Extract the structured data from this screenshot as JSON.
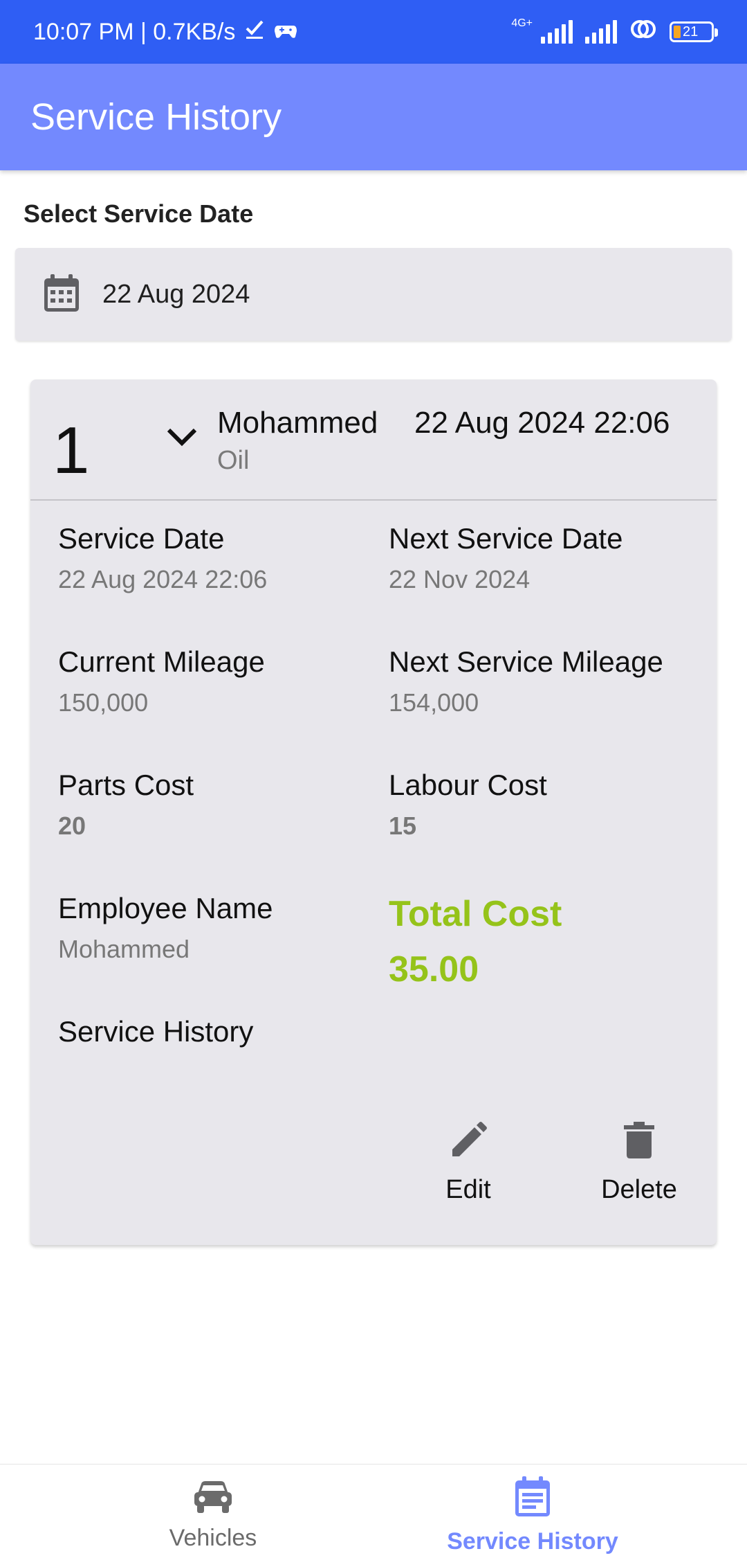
{
  "status_bar": {
    "time_speed": "10:07 PM | 0.7KB/s",
    "network": "4G+",
    "battery": "21",
    "icons": [
      "check-icon",
      "gamepad-icon",
      "signal-icon",
      "signal-icon",
      "hotspot-icon",
      "battery-icon"
    ]
  },
  "app_bar": {
    "title": "Service History"
  },
  "filter": {
    "label": "Select Service Date",
    "selected_date": "22 Aug 2024",
    "icon": "calendar-icon"
  },
  "record": {
    "number": "1",
    "employee": "Mohammed",
    "service_type": "Oil",
    "datetime": "22 Aug 2024 22:06",
    "fields": {
      "service_date": {
        "label": "Service Date",
        "value": "22 Aug 2024 22:06"
      },
      "next_service_date": {
        "label": "Next Service Date",
        "value": "22 Nov 2024"
      },
      "current_mileage": {
        "label": "Current Mileage",
        "value": "150,000"
      },
      "next_service_mileage": {
        "label": "Next Service Mileage",
        "value": "154,000"
      },
      "parts_cost": {
        "label": "Parts Cost",
        "value": "20"
      },
      "labour_cost": {
        "label": "Labour Cost",
        "value": "15"
      },
      "employee_name": {
        "label": "Employee Name",
        "value": "Mohammed"
      },
      "total_cost": {
        "label": "Total Cost",
        "value": "35.00"
      },
      "service_history": {
        "label": "Service History"
      }
    },
    "actions": {
      "edit": "Edit",
      "delete": "Delete"
    }
  },
  "bottom_nav": {
    "items": [
      {
        "label": "Vehicles",
        "icon": "car-icon",
        "active": false
      },
      {
        "label": "Service History",
        "icon": "event-note-icon",
        "active": true
      }
    ]
  },
  "colors": {
    "status_bar": "#2f5ef4",
    "app_bar": "#7389fe",
    "total_cost": "#95c31a",
    "nav_active": "#7389fe",
    "nav_inactive": "#6b6b6b"
  }
}
